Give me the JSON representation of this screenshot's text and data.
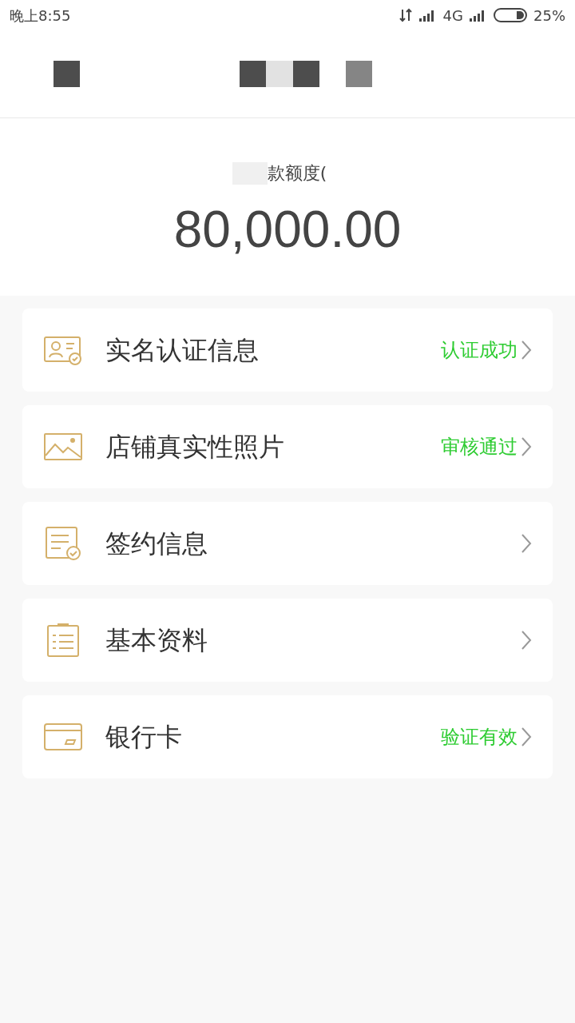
{
  "status_bar": {
    "time": "晚上8:55",
    "network": "4G",
    "battery": "25%"
  },
  "limit": {
    "label": "款额度(",
    "amount": "80,000.00"
  },
  "items": [
    {
      "title": "实名认证信息",
      "status": "认证成功"
    },
    {
      "title": "店铺真实性照片",
      "status": "审核通过"
    },
    {
      "title": "签约信息"
    },
    {
      "title": "基本资料"
    },
    {
      "title": "银行卡",
      "status": "验证有效"
    }
  ]
}
